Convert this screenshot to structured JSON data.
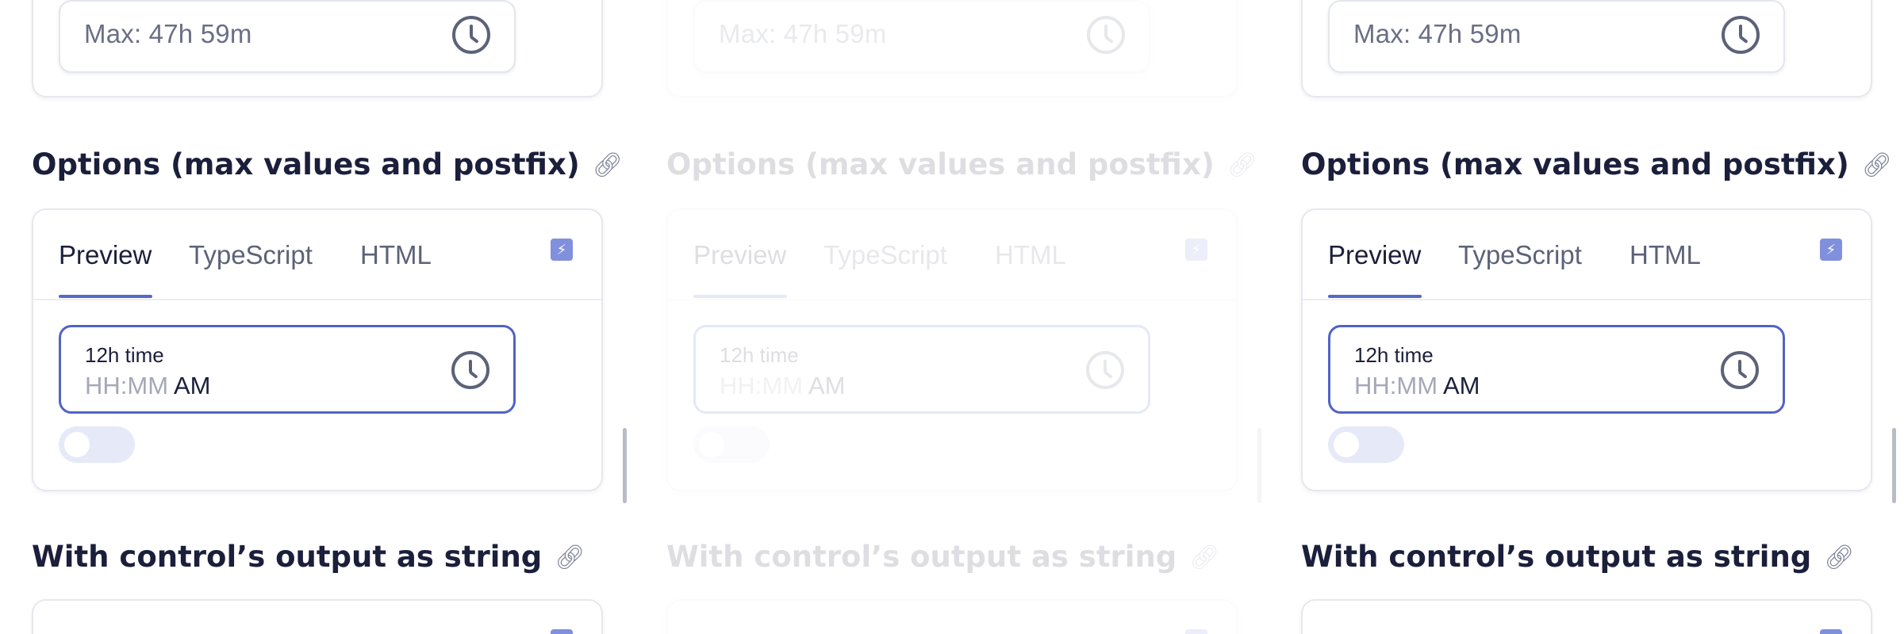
{
  "duration_card": {
    "max_text": "Max: 47h 59m"
  },
  "options_section": {
    "heading": "Options (max values and postfix)",
    "tabs": [
      "Preview",
      "TypeScript",
      "HTML"
    ],
    "active_tab": "Preview",
    "field_label": "12h time",
    "placeholder": "HH:MM",
    "postfix": " AM",
    "toggle_on": false
  },
  "string_section": {
    "heading": "With control’s output as string"
  },
  "icons": [
    "clock-icon",
    "link-icon",
    "bolt-icon"
  ],
  "colors": {
    "accent": "#5163c6",
    "heading": "#1b1f3b",
    "toggle_track": "#e6e9f8"
  }
}
